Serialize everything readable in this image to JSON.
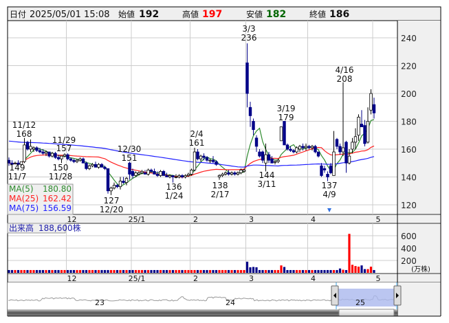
{
  "header": {
    "date_label": "日付",
    "datetime": "2025/05/01 15:08",
    "open_label": "始値",
    "open": "192",
    "high_label": "高値",
    "high": "197",
    "low_label": "安値",
    "low": "182",
    "close_label": "終値",
    "close": "186"
  },
  "colors": {
    "up_volume": "#ff0000",
    "down": "#000088",
    "high": "#ff0000",
    "low": "#006600",
    "ma5": "#2e8b2e",
    "ma25": "#ff2020",
    "ma75": "#2020ff"
  },
  "ma_legend": [
    {
      "label": "MA(5)",
      "value": "180.80"
    },
    {
      "label": "MA(25)",
      "value": "162.42"
    },
    {
      "label": "MA(75)",
      "value": "156.59"
    }
  ],
  "volume_panel": {
    "label": "出来高",
    "value": "188,600株",
    "unit": "(万株)"
  },
  "chart_data": {
    "type": "candlestick",
    "price_ticks": [
      120,
      140,
      160,
      180,
      200,
      220,
      240
    ],
    "price_range": [
      115,
      248
    ],
    "volume_ticks": [
      200,
      400,
      600
    ],
    "month_labels": [
      {
        "label": "12",
        "index": 19
      },
      {
        "label": "25/1",
        "index": 40
      },
      {
        "label": "2",
        "index": 59
      },
      {
        "label": "3",
        "index": 77
      },
      {
        "label": "4",
        "index": 97
      },
      {
        "label": "5",
        "index": 118
      }
    ],
    "annotations": [
      {
        "date": "11/12",
        "value": "168",
        "kind": "high"
      },
      {
        "date": "11/7",
        "value": "149",
        "kind": "low"
      },
      {
        "date": "11/29",
        "value": "157",
        "kind": "high"
      },
      {
        "date": "11/28",
        "value": "150",
        "kind": "low"
      },
      {
        "date": "12/30",
        "value": "151",
        "kind": "high"
      },
      {
        "date": "12/20",
        "value": "127",
        "kind": "low"
      },
      {
        "date": "1/24",
        "value": "136",
        "kind": "low"
      },
      {
        "date": "2/4",
        "value": "161",
        "kind": "high"
      },
      {
        "date": "2/17",
        "value": "138",
        "kind": "low"
      },
      {
        "date": "3/3",
        "value": "236",
        "kind": "high"
      },
      {
        "date": "3/11",
        "value": "144",
        "kind": "low"
      },
      {
        "date": "3/19",
        "value": "179",
        "kind": "high"
      },
      {
        "date": "4/9",
        "value": "137",
        "kind": "low"
      },
      {
        "date": "4/16",
        "value": "208",
        "kind": "high"
      }
    ],
    "candles_ohlc": [
      [
        152,
        154,
        148,
        150
      ],
      [
        150,
        152,
        147,
        149
      ],
      [
        150,
        151,
        149,
        150
      ],
      [
        150,
        152,
        148,
        149
      ],
      [
        149,
        151,
        148,
        151
      ],
      [
        151,
        168,
        150,
        163
      ],
      [
        165,
        166,
        159,
        160
      ],
      [
        160,
        167,
        158,
        162
      ],
      [
        160,
        162,
        158,
        161
      ],
      [
        161,
        162,
        158,
        159
      ],
      [
        159,
        161,
        157,
        158
      ],
      [
        158,
        160,
        156,
        157
      ],
      [
        157,
        159,
        155,
        158
      ],
      [
        158,
        158,
        154,
        155
      ],
      [
        155,
        158,
        154,
        157
      ],
      [
        157,
        158,
        153,
        154
      ],
      [
        154,
        156,
        152,
        153
      ],
      [
        153,
        155,
        150,
        155
      ],
      [
        155,
        157,
        154,
        156
      ],
      [
        156,
        157,
        152,
        153
      ],
      [
        153,
        154,
        151,
        152
      ],
      [
        152,
        153,
        150,
        151
      ],
      [
        151,
        153,
        150,
        152
      ],
      [
        152,
        154,
        151,
        153
      ],
      [
        153,
        154,
        150,
        150
      ],
      [
        150,
        151,
        145,
        146
      ],
      [
        146,
        149,
        145,
        148
      ],
      [
        148,
        150,
        147,
        149
      ],
      [
        149,
        151,
        147,
        147
      ],
      [
        147,
        150,
        146,
        149
      ],
      [
        149,
        150,
        147,
        147
      ],
      [
        147,
        148,
        145,
        146
      ],
      [
        146,
        146,
        128,
        130
      ],
      [
        130,
        133,
        127,
        132
      ],
      [
        132,
        136,
        131,
        134
      ],
      [
        134,
        135,
        132,
        133
      ],
      [
        133,
        140,
        131,
        137
      ],
      [
        137,
        140,
        135,
        136
      ],
      [
        136,
        140,
        134,
        139
      ],
      [
        150,
        151,
        138,
        142
      ],
      [
        144,
        146,
        139,
        141
      ],
      [
        141,
        144,
        140,
        143
      ],
      [
        142,
        144,
        141,
        143
      ],
      [
        143,
        145,
        142,
        144
      ],
      [
        143,
        145,
        142,
        142
      ],
      [
        142,
        146,
        141,
        145
      ],
      [
        145,
        146,
        143,
        144
      ],
      [
        144,
        146,
        142,
        142
      ],
      [
        142,
        144,
        140,
        141
      ],
      [
        141,
        145,
        140,
        144
      ],
      [
        144,
        145,
        141,
        141
      ],
      [
        141,
        143,
        140,
        140
      ],
      [
        140,
        142,
        139,
        141
      ],
      [
        141,
        141,
        136,
        140
      ],
      [
        140,
        142,
        139,
        140
      ],
      [
        140,
        142,
        139,
        141
      ],
      [
        141,
        142,
        139,
        140
      ],
      [
        140,
        142,
        139,
        141
      ],
      [
        141,
        143,
        140,
        142
      ],
      [
        142,
        146,
        141,
        145
      ],
      [
        145,
        161,
        144,
        158
      ],
      [
        158,
        160,
        152,
        153
      ],
      [
        153,
        156,
        151,
        155
      ],
      [
        155,
        157,
        152,
        154
      ],
      [
        154,
        155,
        151,
        152
      ],
      [
        152,
        153,
        150,
        152
      ],
      [
        152,
        155,
        150,
        151
      ],
      [
        151,
        152,
        148,
        149
      ],
      [
        140,
        142,
        138,
        141
      ],
      [
        141,
        143,
        140,
        142
      ],
      [
        142,
        144,
        141,
        143
      ],
      [
        143,
        145,
        141,
        142
      ],
      [
        142,
        144,
        141,
        143
      ],
      [
        143,
        144,
        141,
        142
      ],
      [
        142,
        144,
        141,
        143
      ],
      [
        143,
        146,
        142,
        145
      ],
      [
        144,
        146,
        143,
        145
      ],
      [
        222,
        236,
        190,
        200
      ],
      [
        190,
        194,
        176,
        184
      ],
      [
        180,
        182,
        170,
        174
      ],
      [
        168,
        170,
        158,
        162
      ],
      [
        158,
        160,
        154,
        155
      ],
      [
        158,
        159,
        150,
        152
      ],
      [
        150,
        164,
        144,
        156
      ],
      [
        156,
        158,
        150,
        152
      ],
      [
        153,
        155,
        150,
        150
      ],
      [
        151,
        152,
        149,
        151
      ],
      [
        151,
        153,
        150,
        152
      ],
      [
        166,
        176,
        166,
        176
      ],
      [
        180,
        180,
        163,
        163
      ],
      [
        163,
        164,
        159,
        160
      ],
      [
        160,
        162,
        158,
        159
      ],
      [
        159,
        160,
        157,
        158
      ],
      [
        158,
        162,
        157,
        161
      ],
      [
        160,
        163,
        158,
        162
      ],
      [
        162,
        164,
        159,
        161
      ],
      [
        161,
        164,
        159,
        162
      ],
      [
        162,
        163,
        160,
        161
      ],
      [
        161,
        163,
        159,
        162
      ],
      [
        162,
        163,
        157,
        158
      ],
      [
        158,
        158,
        154,
        155
      ],
      [
        148,
        150,
        140,
        141
      ],
      [
        146,
        148,
        143,
        145
      ],
      [
        142,
        144,
        137,
        140
      ],
      [
        148,
        150,
        142,
        143
      ],
      [
        141,
        173,
        141,
        158
      ],
      [
        167,
        168,
        160,
        162
      ],
      [
        162,
        164,
        156,
        158
      ],
      [
        158,
        208,
        155,
        161
      ],
      [
        165,
        166,
        143,
        150
      ],
      [
        150,
        160,
        149,
        155
      ],
      [
        160,
        168,
        157,
        165
      ],
      [
        165,
        175,
        160,
        169
      ],
      [
        170,
        185,
        166,
        183
      ],
      [
        178,
        188,
        176,
        176
      ],
      [
        177,
        181,
        162,
        164
      ],
      [
        165,
        190,
        164,
        180
      ],
      [
        188,
        203,
        185,
        200
      ],
      [
        192,
        197,
        182,
        186
      ]
    ],
    "volume_10k_shares": [
      45,
      45,
      45,
      45,
      45,
      45,
      45,
      45,
      45,
      45,
      45,
      45,
      45,
      45,
      45,
      45,
      45,
      45,
      45,
      45,
      45,
      45,
      45,
      45,
      45,
      45,
      45,
      45,
      45,
      45,
      45,
      45,
      45,
      45,
      45,
      45,
      45,
      45,
      45,
      45,
      45,
      45,
      45,
      45,
      45,
      45,
      45,
      45,
      45,
      45,
      45,
      45,
      45,
      45,
      45,
      45,
      45,
      45,
      45,
      45,
      45,
      45,
      45,
      45,
      45,
      45,
      45,
      45,
      45,
      45,
      45,
      45,
      45,
      45,
      45,
      45,
      45,
      180,
      90,
      95,
      90,
      45,
      45,
      45,
      45,
      45,
      45,
      45,
      120,
      95,
      45,
      45,
      45,
      45,
      45,
      45,
      45,
      45,
      45,
      45,
      45,
      45,
      45,
      45,
      45,
      45,
      45,
      70,
      50,
      45,
      630,
      130,
      110,
      100,
      120,
      60,
      60,
      100,
      45
    ],
    "navigator_labels": [
      "23",
      "24",
      "25"
    ]
  }
}
